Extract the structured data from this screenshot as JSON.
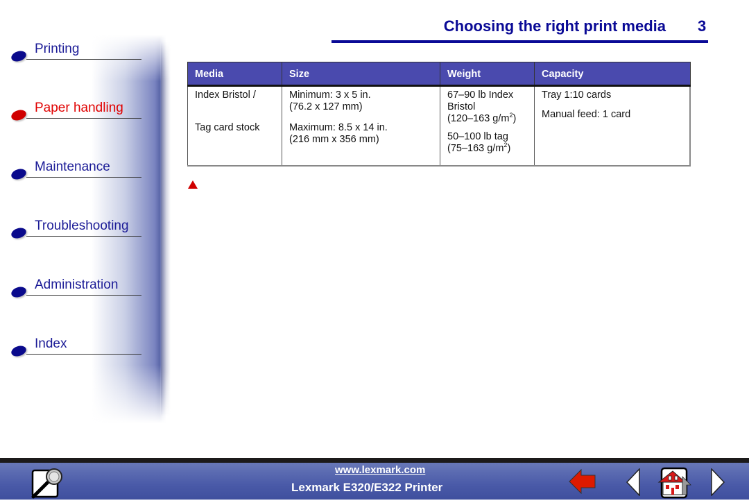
{
  "header": {
    "title": "Choosing the right print media",
    "page_number": "3"
  },
  "sidebar": {
    "items": [
      {
        "label": "Printing",
        "active": false
      },
      {
        "label": "Paper handling",
        "active": true
      },
      {
        "label": "Maintenance",
        "active": false
      },
      {
        "label": "Troubleshooting",
        "active": false
      },
      {
        "label": "Administration",
        "active": false
      },
      {
        "label": "Index",
        "active": false
      }
    ]
  },
  "table": {
    "headers": [
      "Media",
      "Size",
      "Weight",
      "Capacity"
    ],
    "row": {
      "media": [
        "Index Bristol /",
        "Tag card stock"
      ],
      "size": [
        {
          "line1": "Minimum: 3 x 5 in.",
          "line2": "(76.2 x 127 mm)"
        },
        {
          "line1": "Maximum: 8.5 x 14 in.",
          "line2": "(216 mm x 356 mm)"
        }
      ],
      "weight": [
        {
          "line1": "67–90 lb Index",
          "line2": "Bristol",
          "line3": "(120–163 g/m",
          "sup": "2",
          "close": ")"
        },
        {
          "line1": "50–100 lb tag",
          "line2": "(75–163 g/m",
          "sup": "2",
          "close": ")"
        }
      ],
      "capacity": [
        "Tray 1:10 cards",
        "Manual feed: 1 card"
      ]
    }
  },
  "footer": {
    "url": "www.lexmark.com",
    "product": "Lexmark E320/E322 Printer",
    "icons": [
      "search-icon",
      "back-arrow-icon",
      "previous-page-icon",
      "home-icon",
      "next-page-icon"
    ]
  },
  "colors": {
    "brand_blue": "#0a0a96",
    "active_red": "#e00000",
    "table_header": "#4a4aae",
    "footer_blue": "#4a5aa8"
  }
}
